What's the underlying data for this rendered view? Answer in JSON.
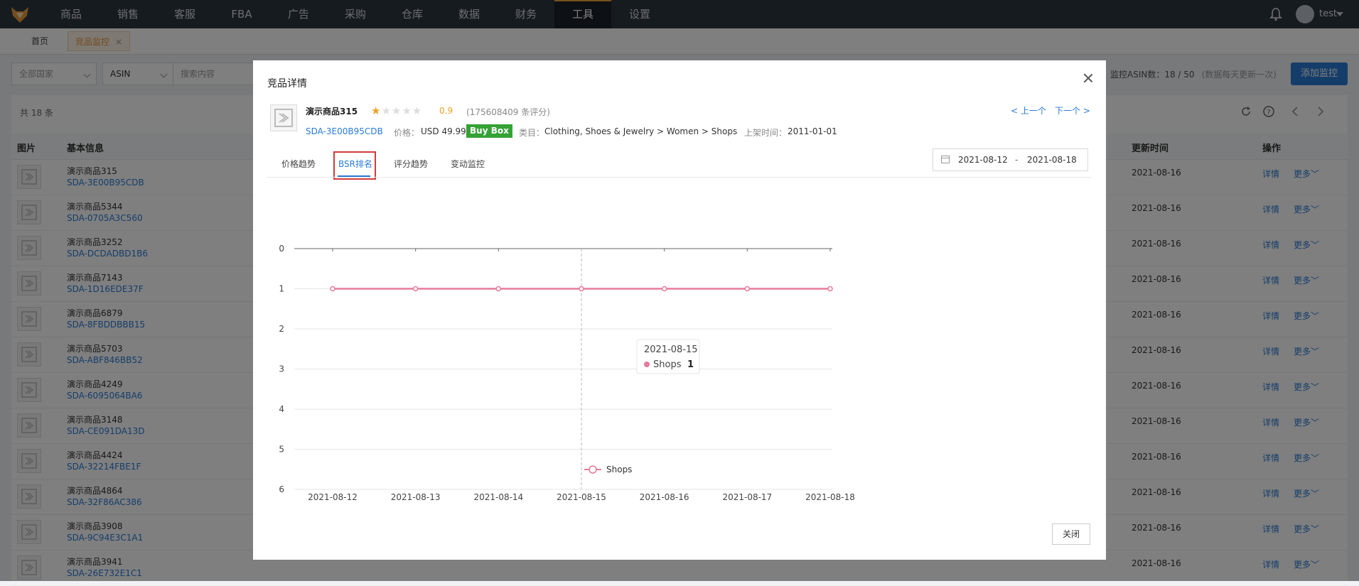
{
  "nav": {
    "items": [
      "商品",
      "销售",
      "客服",
      "FBA",
      "广告",
      "采购",
      "仓库",
      "数据",
      "财务",
      "工具",
      "设置"
    ],
    "active_index": 9,
    "username": "test"
  },
  "page_tabs": {
    "home": "首页",
    "current": "竞品监控"
  },
  "filters": {
    "country": "全部国家",
    "field": "ASIN",
    "search_placeholder": "搜索内容"
  },
  "monitor": {
    "count_text": "监控ASIN数：18 / 50",
    "note": "(数据每天更新一次)",
    "add_button": "添加监控"
  },
  "list": {
    "total": "共 18 条",
    "headers": {
      "image": "图片",
      "basic": "基本信息",
      "updated": "更新时间",
      "actions": "操作"
    },
    "detail_label": "详情",
    "more_label": "更多",
    "rows": [
      {
        "name": "演示商品315",
        "sku": "SDA-3E00B95CDB",
        "updated": "2021-08-16"
      },
      {
        "name": "演示商品5344",
        "sku": "SDA-0705A3C560",
        "updated": "2021-08-16"
      },
      {
        "name": "演示商品3252",
        "sku": "SDA-DCDADBD1B6",
        "updated": "2021-08-16"
      },
      {
        "name": "演示商品7143",
        "sku": "SDA-1D16EDE37F",
        "updated": "2021-08-16"
      },
      {
        "name": "演示商品6879",
        "sku": "SDA-8FBDDBBB15",
        "updated": "2021-08-16"
      },
      {
        "name": "演示商品5703",
        "sku": "SDA-ABF846BB52",
        "updated": "2021-08-16"
      },
      {
        "name": "演示商品4249",
        "sku": "SDA-6095064BA6",
        "updated": "2021-08-16"
      },
      {
        "name": "演示商品3148",
        "sku": "SDA-CE091DA13D",
        "updated": "2021-08-16"
      },
      {
        "name": "演示商品4424",
        "sku": "SDA-32214FBE1F",
        "updated": "2021-08-16"
      },
      {
        "name": "演示商品4864",
        "sku": "SDA-32F86AC386",
        "updated": "2021-08-16"
      },
      {
        "name": "演示商品3908",
        "sku": "SDA-9C94E3C1A1",
        "updated": "2021-08-16"
      },
      {
        "name": "演示商品3941",
        "sku": "SDA-26E732E1C1",
        "updated": "2021-08-16"
      }
    ]
  },
  "modal": {
    "title": "竞品详情",
    "product": {
      "name": "演示商品315",
      "rating_value": 0.9,
      "rating_text": "0.9",
      "reviews": "(175608409 条评分)",
      "sku": "SDA-3E00B95CDB",
      "price_label": "价格：",
      "price": "USD 49.99",
      "buybox": "Buy Box",
      "category_label": "类目：",
      "category": "Clothing, Shoes & Jewelry > Women > Shops",
      "listed_label": "上架时间：",
      "listed": "2011-01-01"
    },
    "prev": "< 上一个",
    "next": "下一个 >",
    "tabs": [
      "价格趋势",
      "BSR排名",
      "评分趋势",
      "变动监控"
    ],
    "active_tab": 1,
    "date_from": "2021-08-12",
    "date_to": "2021-08-18",
    "date_sep": "-",
    "close_button": "关闭",
    "tooltip": {
      "date": "2021-08-15",
      "series": "Shops",
      "value": "1"
    }
  },
  "colors": {
    "accent": "#2a7bd5",
    "series": "#e87a9a",
    "buybox": "#35a235",
    "star": "#f0a020",
    "nav_bg": "#2d3640"
  },
  "chart_data": {
    "type": "line",
    "x": [
      "2021-08-12",
      "2021-08-13",
      "2021-08-14",
      "2021-08-15",
      "2021-08-16",
      "2021-08-17",
      "2021-08-18"
    ],
    "series": [
      {
        "name": "Shops",
        "values": [
          1,
          1,
          1,
          1,
          1,
          1,
          1
        ]
      }
    ],
    "ylim": [
      0,
      6
    ],
    "y_ticks": [
      "0",
      "1",
      "2",
      "3",
      "4",
      "5",
      "6"
    ],
    "y_inverted": true,
    "grid": true,
    "legend": "bottom"
  }
}
